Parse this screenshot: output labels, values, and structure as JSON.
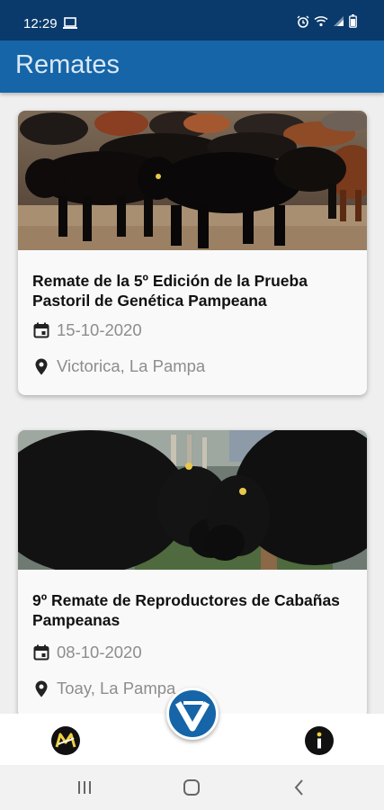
{
  "status_bar": {
    "time": "12:29",
    "icons": [
      "laptop-icon",
      "alarm-icon",
      "wifi-icon",
      "signal-icon",
      "battery-icon"
    ]
  },
  "app_bar": {
    "title": "Remates"
  },
  "cards": [
    {
      "title": "Remate de la 5º Edición de la Prueba Pastoril de Genética Pampeana",
      "date": "15-10-2020",
      "location": "Victorica, La Pampa",
      "image": "herd-of-black-angus-cattle"
    },
    {
      "title": "9º Remate de Reproductores de Cabañas Pampeanas",
      "date": "08-10-2020",
      "location": "Toay, La Pampa",
      "image": "two-black-bulls-head-to-head"
    }
  ],
  "bottom_nav": {
    "left_icon": "m-logo-icon",
    "center_icon": "v-logo-icon",
    "right_icon": "info-icon"
  },
  "system_nav": {
    "buttons": [
      "recent-apps-icon",
      "home-icon",
      "back-icon"
    ]
  },
  "colors": {
    "status_bar": "#0a3a6b",
    "app_bar": "#1565a8",
    "background": "#efefef",
    "card": "#f9f9f9",
    "meta_text": "#8d8d8d"
  }
}
